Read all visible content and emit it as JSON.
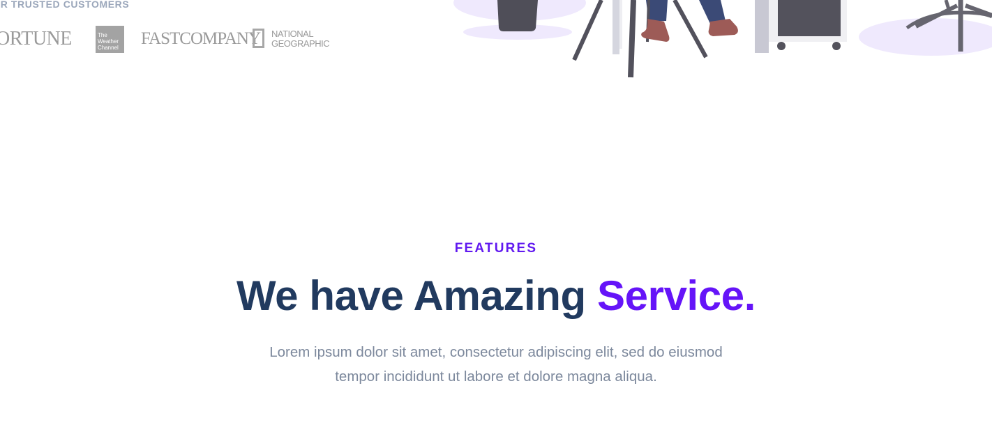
{
  "customers": {
    "label": "UR TRUSTED CUSTOMERS",
    "logos": {
      "fortune": "ORTUNE",
      "weather": [
        "The",
        "Weather",
        "Channel"
      ],
      "fastcompany": "FASTCOMPANY",
      "natgeo": [
        "NATIONAL",
        "GEOGRAPHIC"
      ]
    }
  },
  "features": {
    "eyebrow": "FEATURES",
    "headline_main": "We have Amazing ",
    "headline_accent": "Service.",
    "description": "Lorem ipsum dolor sit amet, consectetur adipiscing elit, sed do eiusmod tempor incididunt ut labore et dolore magna aliqua."
  },
  "colors": {
    "accent": "#6514f8",
    "heading": "#213a5f",
    "muted": "#7c889c",
    "illustration_shadow": "#efe9fd",
    "illustration_dark": "#4f4e58"
  }
}
